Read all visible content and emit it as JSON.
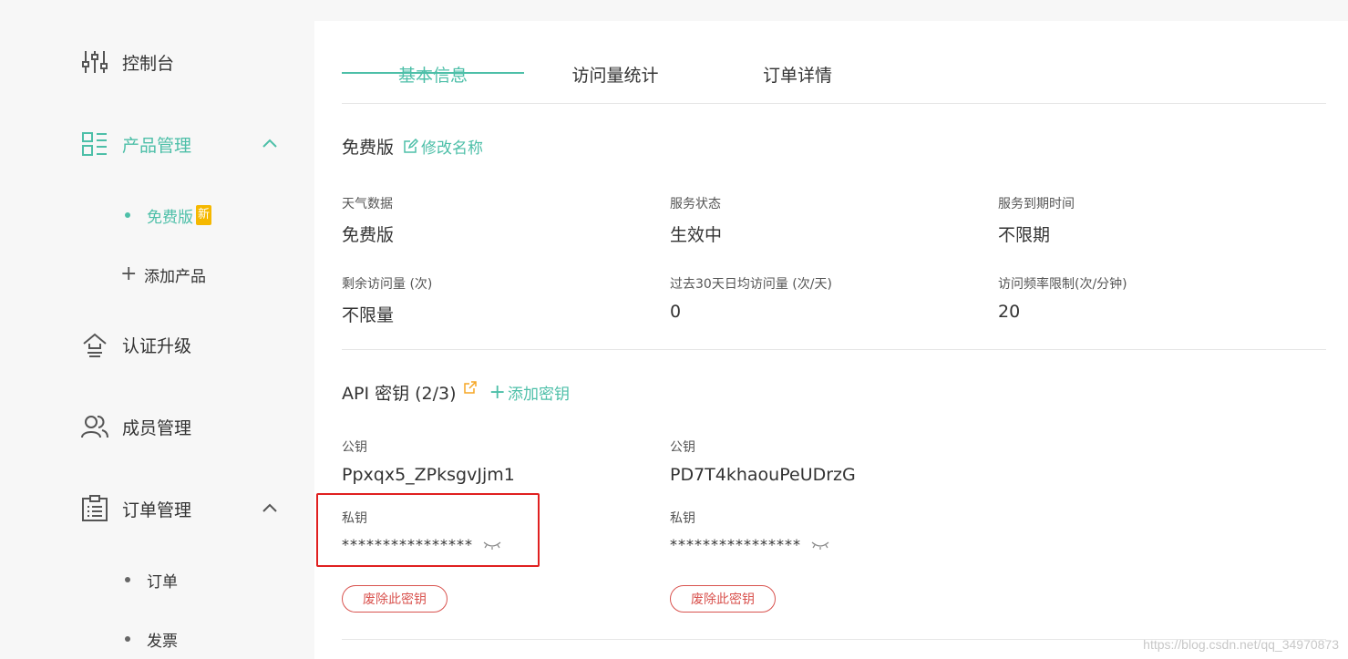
{
  "sidebar": {
    "items": [
      {
        "label": "控制台",
        "icon": "sliders-icon"
      },
      {
        "label": "产品管理",
        "icon": "product-grid-icon"
      },
      {
        "label": "认证升级",
        "icon": "upgrade-icon"
      },
      {
        "label": "成员管理",
        "icon": "members-icon"
      },
      {
        "label": "订单管理",
        "icon": "order-clipboard-icon"
      }
    ],
    "product_sub": {
      "free": "免费版",
      "new_badge": "新",
      "add": "添加产品"
    },
    "order_sub": {
      "orders": "订单",
      "invoice": "发票"
    }
  },
  "tabs": [
    "基本信息",
    "访问量统计",
    "订单详情"
  ],
  "plan": {
    "name": "免费版",
    "edit_label": "修改名称"
  },
  "info": [
    {
      "key": "天气数据",
      "value": "免费版"
    },
    {
      "key": "服务状态",
      "value": "生效中"
    },
    {
      "key": "服务到期时间",
      "value": "不限期"
    },
    {
      "key": "剩余访问量 (次)",
      "value": "不限量"
    },
    {
      "key": "过去30天日均访问量 (次/天)",
      "value": "0"
    },
    {
      "key": "访问频率限制(次/分钟)",
      "value": "20"
    }
  ],
  "api": {
    "title": "API 密钥 (2/3)",
    "add_label": "添加密钥",
    "keys": [
      {
        "public_label": "公钥",
        "public_value": "Ppxqx5_ZPksgvJjm1",
        "private_label": "私钥",
        "private_value": "****************",
        "revoke_label": "废除此密钥"
      },
      {
        "public_label": "公钥",
        "public_value": "PD7T4khaouPeUDrzG",
        "private_label": "私钥",
        "private_value": "****************",
        "revoke_label": "废除此密钥"
      }
    ]
  },
  "colors": {
    "accent": "#4dbfa8",
    "danger": "#d9534f",
    "badge": "#f5b800",
    "highlight": "#e02020"
  },
  "watermark": "https://blog.csdn.net/qq_34970873"
}
